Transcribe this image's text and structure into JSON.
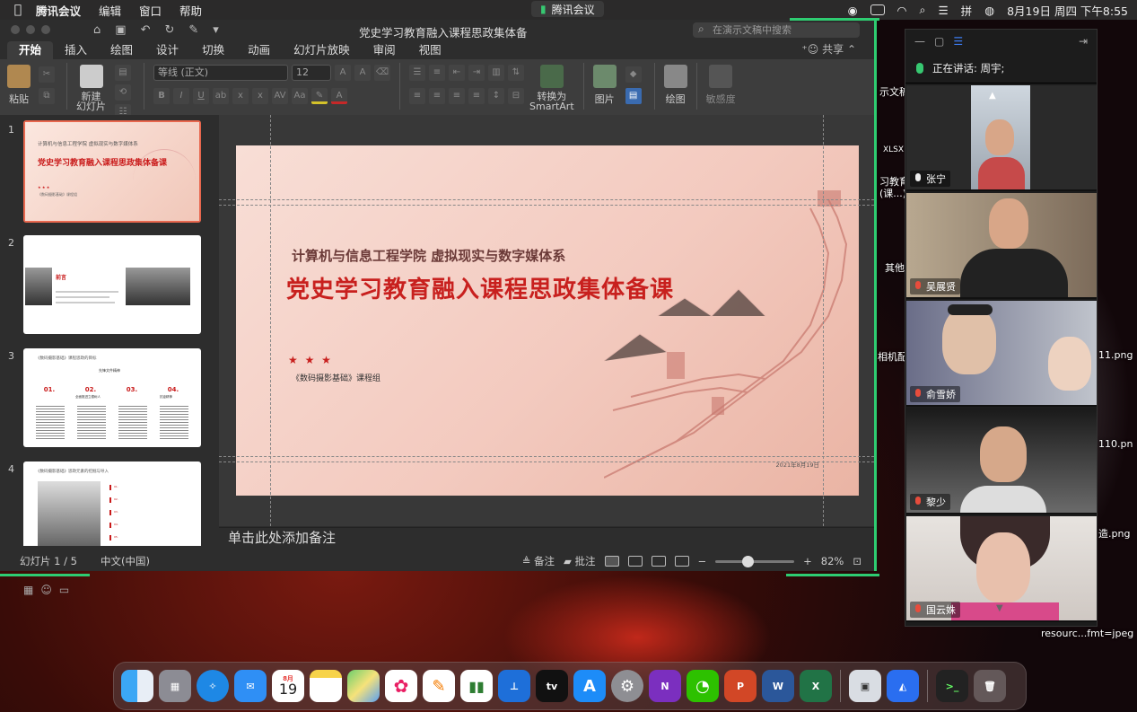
{
  "menubar": {
    "apple": "",
    "app_name": "腾讯会议",
    "items": [
      "编辑",
      "窗口",
      "帮助"
    ],
    "center_label": "腾讯会议",
    "datetime": "8月19日 周四 下午8:55"
  },
  "ppt": {
    "doc_title": "党史学习教育融入课程思政集体备",
    "search_placeholder": "在演示文稿中搜索",
    "tabs": [
      "开始",
      "插入",
      "绘图",
      "设计",
      "切换",
      "动画",
      "幻灯片放映",
      "审阅",
      "视图"
    ],
    "share": "共享",
    "ribbon": {
      "paste": "粘贴",
      "new_slide": "新建\n幻灯片",
      "font": "等线 (正文)",
      "size": "12",
      "convert": "转换为\nSmartArt",
      "picture": "图片",
      "draw": "绘图",
      "sensitivity": "敏感度"
    },
    "thumbs": [
      {
        "num": "1",
        "sub": "计算机与信息工程学院 虚拟现实与数字媒体系",
        "title": "党史学习教育融入课程思政集体备课",
        "stars": "★ ★ ★",
        "group": "《数码摄影基础》课程组",
        "date": "2021年8月19日"
      },
      {
        "num": "2",
        "head": "前言"
      },
      {
        "num": "3",
        "title": "《数码摄影基础》课程思政的目标",
        "center": "先锋文件精神",
        "cols": [
          "01.",
          "02.",
          "03.",
          "04."
        ],
        "col_labels": [
          "",
          "全面推进立德树人",
          "",
          "抗疫精神"
        ]
      },
      {
        "num": "4",
        "title": "《数码摄影基础》思政元素的挖掘与导入",
        "items": [
          "01.",
          "02.",
          "03.",
          "04.",
          "05."
        ]
      }
    ],
    "slide": {
      "subtitle": "计算机与信息工程学院 虚拟现实与数字媒体系",
      "title": "党史学习教育融入课程思政集体备课",
      "stars": "★ ★ ★",
      "group": "《数码摄影基础》课程组",
      "date": "2021年8月19日"
    },
    "notes_placeholder": "单击此处添加备注",
    "status": {
      "slide_info": "幻灯片 1 / 5",
      "language": "中文(中国)",
      "notes_btn": "备注",
      "comments_btn": "批注",
      "zoom": "82%"
    }
  },
  "meeting": {
    "speaking": "正在讲话: 周宇;",
    "participants": [
      "张宁",
      "吴展贤",
      "俞雪娇",
      "黎少",
      "国云姝"
    ]
  },
  "desktop_labels": [
    "示文稿",
    "XLSX",
    "习教育",
    "(课...)(",
    "其他",
    "相机配",
    "11.png",
    "110.pn",
    "造.png",
    "resourc...fmt=jpeg"
  ],
  "dock": {
    "calendar_month": "8月",
    "calendar_day": "19",
    "apple_tv": "tv",
    "apps": [
      "Finder",
      "Launchpad",
      "Safari",
      "Mail",
      "Calendar",
      "Notes",
      "Maps",
      "Photos",
      "Pages",
      "Numbers",
      "Keynote",
      "TV",
      "App Store",
      "System Preferences",
      "OneNote",
      "WeChat",
      "PowerPoint",
      "Word",
      "Excel",
      "Preview",
      "Tencent Meeting",
      "Terminal",
      "Trash"
    ]
  },
  "colors": {
    "accent_green": "#2ecc71",
    "slide_red": "#c8201e"
  }
}
